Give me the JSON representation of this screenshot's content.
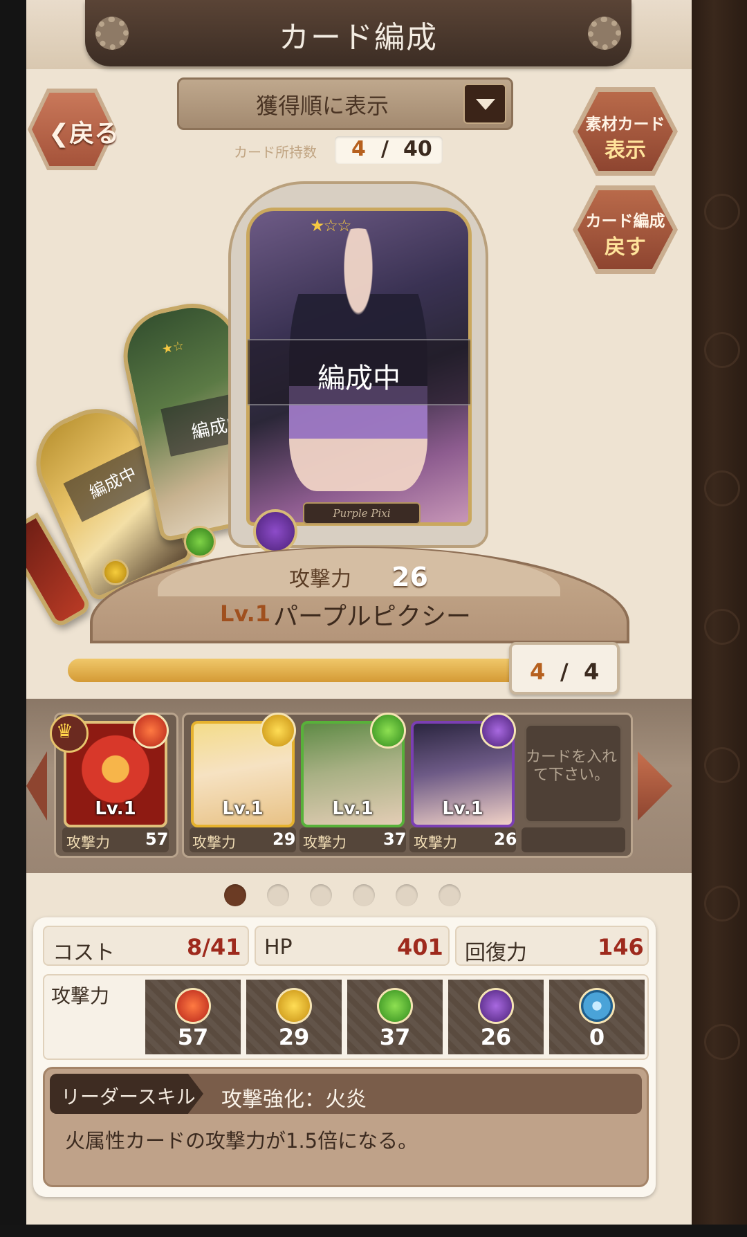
{
  "header": {
    "title": "カード編成",
    "back_label": "戻る",
    "sort_label": "獲得順に表示",
    "owned_label": "カード所持数",
    "owned_current": "4",
    "owned_sep": "/",
    "owned_max": "40",
    "material_line1": "素材カード",
    "material_line2": "表示",
    "revert_line1": "カード編成",
    "revert_line2": "戻す"
  },
  "carousel": {
    "main_card": {
      "stars": "★☆☆",
      "status": "編成中",
      "name_plate": "Purple Pixi",
      "element": "dark-icon",
      "color": "#7b3fb3"
    },
    "side_cards": [
      {
        "status": "編成中",
        "stars": "★☆",
        "element": "wind-icon"
      },
      {
        "status": "編成中",
        "element": "light-icon"
      }
    ]
  },
  "selected": {
    "atk_label": "攻撃力",
    "atk_value": "26",
    "level": "Lv.1",
    "name": "パープルピクシー"
  },
  "deck_progress": {
    "current": "4",
    "sep": "/",
    "max": "4",
    "fill_fraction": 1.0
  },
  "deck": {
    "leader_crown": "♛",
    "slots": [
      {
        "level": "Lv.1",
        "atk_label": "攻撃力",
        "atk": "57",
        "element": "fire-icon",
        "color": "#d8382a"
      },
      {
        "level": "Lv.1",
        "atk_label": "攻撃力",
        "atk": "29",
        "element": "light-icon",
        "color": "#e6b22e"
      },
      {
        "level": "Lv.1",
        "atk_label": "攻撃力",
        "atk": "37",
        "element": "wind-icon",
        "color": "#58b13a"
      },
      {
        "level": "Lv.1",
        "atk_label": "攻撃力",
        "atk": "26",
        "element": "dark-icon",
        "color": "#7b3fb3"
      }
    ],
    "empty_text": "カードを入れて下さい。"
  },
  "pagination": {
    "total": 6,
    "current": 1
  },
  "stats": {
    "cost_label": "コスト",
    "cost_value": "8/41",
    "hp_label": "HP",
    "hp_value": "401",
    "recovery_label": "回復力",
    "recovery_value": "146",
    "atk_label": "攻撃力",
    "atk_by_element": [
      {
        "element": "fire-icon",
        "value": "57"
      },
      {
        "element": "light-icon",
        "value": "29"
      },
      {
        "element": "wind-icon",
        "value": "37"
      },
      {
        "element": "dark-icon",
        "value": "26"
      },
      {
        "element": "water-icon",
        "value": "0"
      }
    ]
  },
  "leader_skill": {
    "tag": "リーダースキル",
    "name": "攻撃強化：火炎",
    "description": "火属性カードの攻撃力が1.5倍になる。"
  }
}
